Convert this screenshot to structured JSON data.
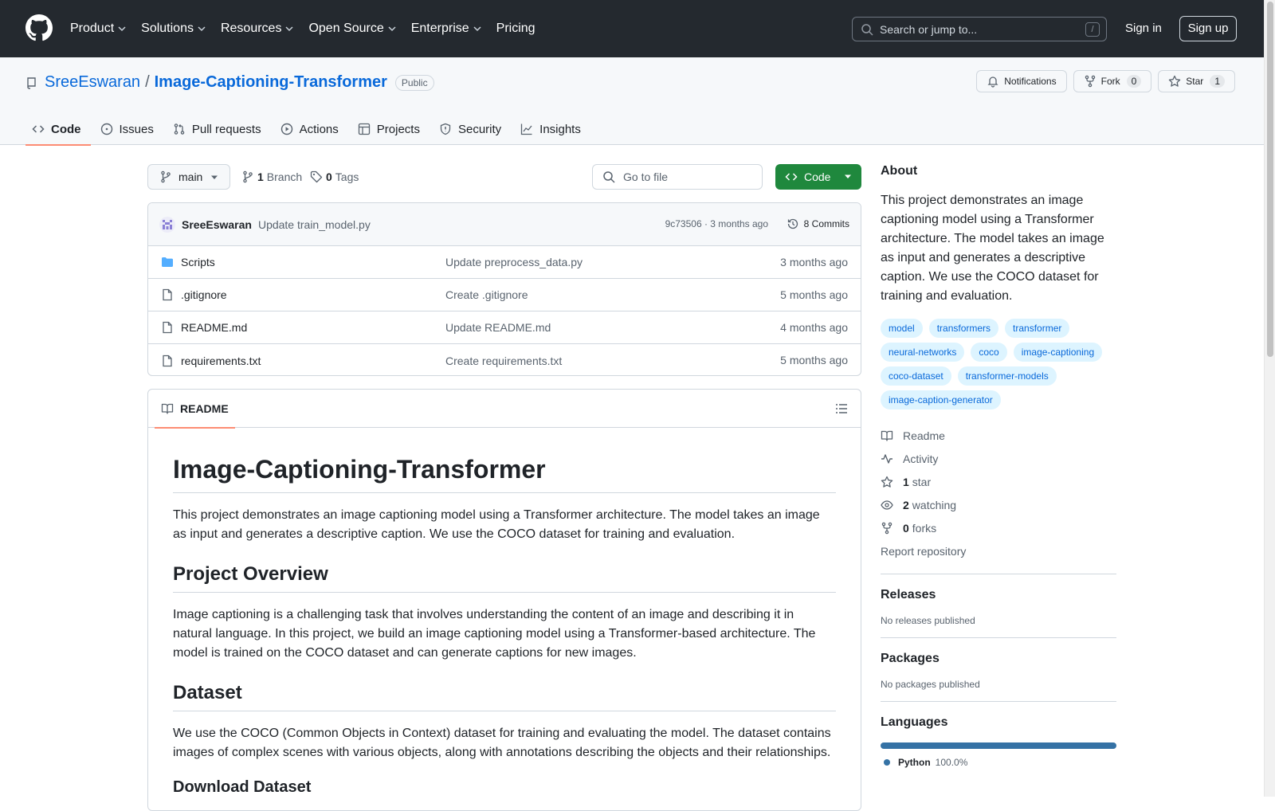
{
  "header": {
    "nav": [
      {
        "label": "Product"
      },
      {
        "label": "Solutions"
      },
      {
        "label": "Resources"
      },
      {
        "label": "Open Source"
      },
      {
        "label": "Enterprise"
      },
      {
        "label": "Pricing"
      }
    ],
    "search_placeholder": "Search or jump to...",
    "search_shortcut": "/",
    "signin": "Sign in",
    "signup": "Sign up"
  },
  "repo": {
    "owner": "SreeEswaran",
    "separator": "/",
    "name": "Image-Captioning-Transformer",
    "visibility": "Public",
    "notifications_label": "Notifications",
    "fork_label": "Fork",
    "fork_count": "0",
    "star_label": "Star",
    "star_count": "1",
    "tabs": [
      {
        "label": "Code",
        "icon": "code-icon"
      },
      {
        "label": "Issues",
        "icon": "issue-icon"
      },
      {
        "label": "Pull requests",
        "icon": "pull-request-icon"
      },
      {
        "label": "Actions",
        "icon": "play-icon"
      },
      {
        "label": "Projects",
        "icon": "table-icon"
      },
      {
        "label": "Security",
        "icon": "shield-icon"
      },
      {
        "label": "Insights",
        "icon": "graph-icon"
      }
    ]
  },
  "toolbar": {
    "branch": "main",
    "branch_count": "1",
    "branch_label": "Branch",
    "tag_count": "0",
    "tag_label": "Tags",
    "goto_placeholder": "Go to file",
    "code_label": "Code"
  },
  "commit": {
    "author": "SreeEswaran",
    "message": "Update train_model.py",
    "hash_age": "9c73506 · 3 months ago",
    "commits": "8 Commits"
  },
  "files": [
    {
      "name": "Scripts",
      "type": "folder",
      "commit": "Update preprocess_data.py",
      "age": "3 months ago"
    },
    {
      "name": ".gitignore",
      "type": "file",
      "commit": "Create .gitignore",
      "age": "5 months ago"
    },
    {
      "name": "README.md",
      "type": "file",
      "commit": "Update README.md",
      "age": "4 months ago"
    },
    {
      "name": "requirements.txt",
      "type": "file",
      "commit": "Create requirements.txt",
      "age": "5 months ago"
    }
  ],
  "readme": {
    "tab": "README",
    "h1": "Image-Captioning-Transformer",
    "p1": "This project demonstrates an image captioning model using a Transformer architecture. The model takes an image as input and generates a descriptive caption. We use the COCO dataset for training and evaluation.",
    "h2_overview": "Project Overview",
    "p2": "Image captioning is a challenging task that involves understanding the content of an image and describing it in natural language. In this project, we build an image captioning model using a Transformer-based architecture. The model is trained on the COCO dataset and can generate captions for new images.",
    "h2_dataset": "Dataset",
    "p3": "We use the COCO (Common Objects in Context) dataset for training and evaluating the model. The dataset contains images of complex scenes with various objects, along with annotations describing the objects and their relationships.",
    "h3_download": "Download Dataset"
  },
  "about": {
    "title": "About",
    "description": "This project demonstrates an image captioning model using a Transformer architecture. The model takes an image as input and generates a descriptive caption. We use the COCO dataset for training and evaluation.",
    "topics": [
      "model",
      "transformers",
      "transformer",
      "neural-networks",
      "coco",
      "image-captioning",
      "coco-dataset",
      "transformer-models",
      "image-caption-generator"
    ],
    "readme": "Readme",
    "activity": "Activity",
    "stars_count": "1",
    "stars_label": "star",
    "watching_count": "2",
    "watching_label": "watching",
    "forks_count": "0",
    "forks_label": "forks",
    "report": "Report repository"
  },
  "releases": {
    "title": "Releases",
    "empty": "No releases published"
  },
  "packages": {
    "title": "Packages",
    "empty": "No packages published"
  },
  "languages": {
    "title": "Languages",
    "items": [
      {
        "name": "Python",
        "percent": "100.0%",
        "color": "#3572a5"
      }
    ]
  },
  "colors": {
    "header_bg": "#24292f",
    "link": "#0969da",
    "primary_button": "#1f883d",
    "active_tab": "#fd8c73"
  }
}
